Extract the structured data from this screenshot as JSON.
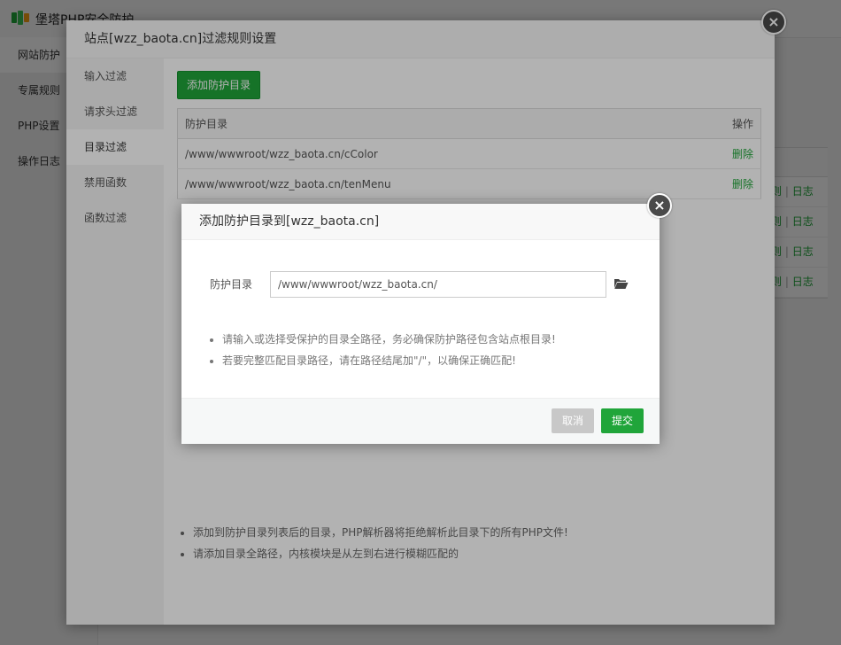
{
  "base": {
    "app_title": "堡塔PHP安全防护",
    "sidebar": [
      {
        "label": "网站防护"
      },
      {
        "label": "专属规则"
      },
      {
        "label": "PHP设置"
      },
      {
        "label": "操作日志"
      }
    ],
    "row_links": {
      "left": "则",
      "sep": "|",
      "right": "日志"
    }
  },
  "layer1": {
    "title": "站点[wzz_baota.cn]过滤规则设置",
    "close_label": "×",
    "nav": [
      {
        "label": "输入过滤"
      },
      {
        "label": "请求头过滤"
      },
      {
        "label": "目录过滤"
      },
      {
        "label": "禁用函数"
      },
      {
        "label": "函数过滤"
      }
    ],
    "add_button": "添加防护目录",
    "table": {
      "headers": [
        "防护目录",
        "操作"
      ],
      "rows": [
        {
          "path": "/www/wwwroot/wzz_baota.cn/cColor",
          "action": "删除"
        },
        {
          "path": "/www/wwwroot/wzz_baota.cn/tenMenu",
          "action": "删除"
        }
      ]
    },
    "tips": [
      "添加到防护目录列表后的目录，PHP解析器将拒绝解析此目录下的所有PHP文件!",
      "请添加目录全路径，内核模块是从左到右进行模糊匹配的"
    ]
  },
  "dialog": {
    "title": "添加防护目录到[wzz_baota.cn]",
    "close_label": "×",
    "field_label": "防护目录",
    "path_value": "/www/wwwroot/wzz_baota.cn/",
    "tips": [
      "请输入或选择受保护的目录全路径，务必确保防护路径包含站点根目录!",
      "若要完整匹配目录路径，请在路径结尾加\"/\"，以确保正确匹配!"
    ],
    "cancel_label": "取消",
    "submit_label": "提交"
  },
  "colors": {
    "accent": "#20a53a",
    "overlay": "rgba(0,0,0,0.3)"
  }
}
